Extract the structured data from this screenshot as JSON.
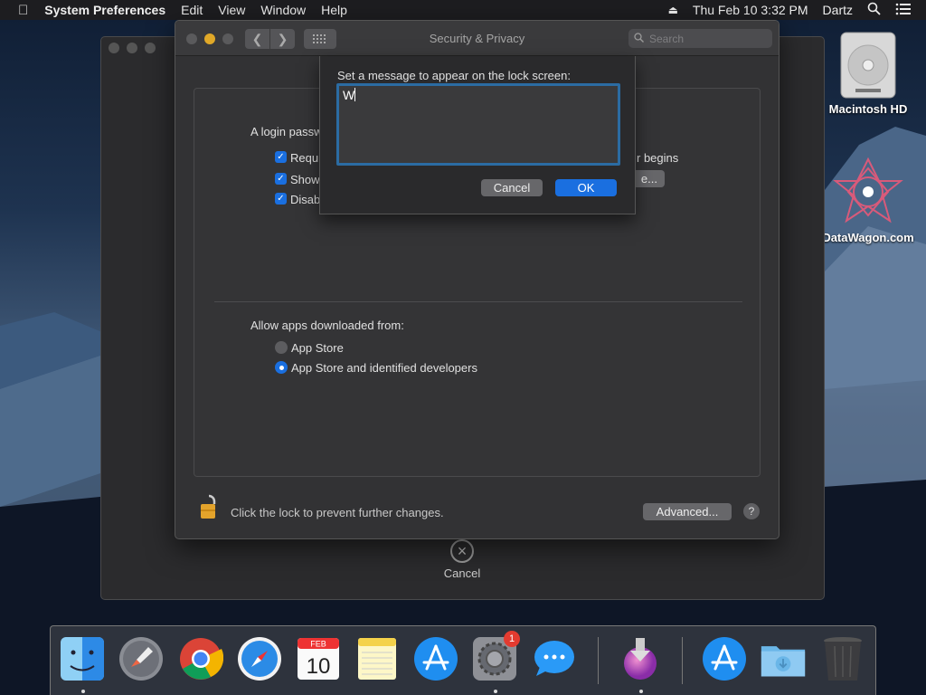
{
  "menubar": {
    "app_name": "System Preferences",
    "items": [
      "Edit",
      "View",
      "Window",
      "Help"
    ],
    "clock": "Thu Feb 10  3:32 PM",
    "user": "Dartz"
  },
  "window": {
    "title": "Security & Privacy",
    "search_placeholder": "Search"
  },
  "general": {
    "login_label_partial": "A login passw",
    "require_partial": "Requi",
    "require_end": "r begins",
    "show_partial": "Show",
    "disable_partial": "Disab",
    "set_button_partial": "e..."
  },
  "gatekeeper": {
    "label": "Allow apps downloaded from:",
    "options": [
      {
        "label": "App Store",
        "selected": false
      },
      {
        "label": "App Store and identified developers",
        "selected": true
      }
    ]
  },
  "footer": {
    "lock_text": "Click the lock to prevent further changes.",
    "advanced_label": "Advanced...",
    "help_label": "?"
  },
  "sheet": {
    "label": "Set a message to appear on the lock screen:",
    "text_value": "W",
    "cancel_label": "Cancel",
    "ok_label": "OK"
  },
  "back_window": {
    "cancel_label": "Cancel"
  },
  "desktop": {
    "icons": [
      {
        "label": "Macintosh HD",
        "icon": "hard-drive-icon"
      },
      {
        "label": "DataWagon.com",
        "icon": "datawagon-logo-icon"
      }
    ]
  },
  "dock": {
    "items": [
      {
        "name": "Finder",
        "icon": "finder-icon",
        "running": true
      },
      {
        "name": "Launchpad",
        "icon": "launchpad-icon",
        "running": false
      },
      {
        "name": "Google Chrome",
        "icon": "chrome-icon",
        "running": false
      },
      {
        "name": "Safari",
        "icon": "safari-icon",
        "running": false
      },
      {
        "name": "Calendar",
        "icon": "calendar-icon",
        "running": false,
        "month": "FEB",
        "day": "10"
      },
      {
        "name": "Notes",
        "icon": "notes-icon",
        "running": false
      },
      {
        "name": "App Store",
        "icon": "app-store-icon",
        "running": false
      },
      {
        "name": "System Preferences",
        "icon": "system-preferences-icon",
        "running": true,
        "badge": "1"
      },
      {
        "name": "Messages",
        "icon": "messages-icon",
        "running": false
      },
      {
        "name": "Installer",
        "icon": "installer-icon",
        "running": true
      },
      {
        "name": "App Store",
        "icon": "app-store-icon",
        "running": false
      },
      {
        "name": "Downloads",
        "icon": "downloads-folder-icon",
        "running": false
      },
      {
        "name": "Trash",
        "icon": "trash-icon",
        "running": false
      }
    ]
  },
  "colors": {
    "accent": "#1a6fe0",
    "window_bg": "#323234",
    "focus_ring": "#2b6ca3",
    "minimize": "#e0a828"
  }
}
